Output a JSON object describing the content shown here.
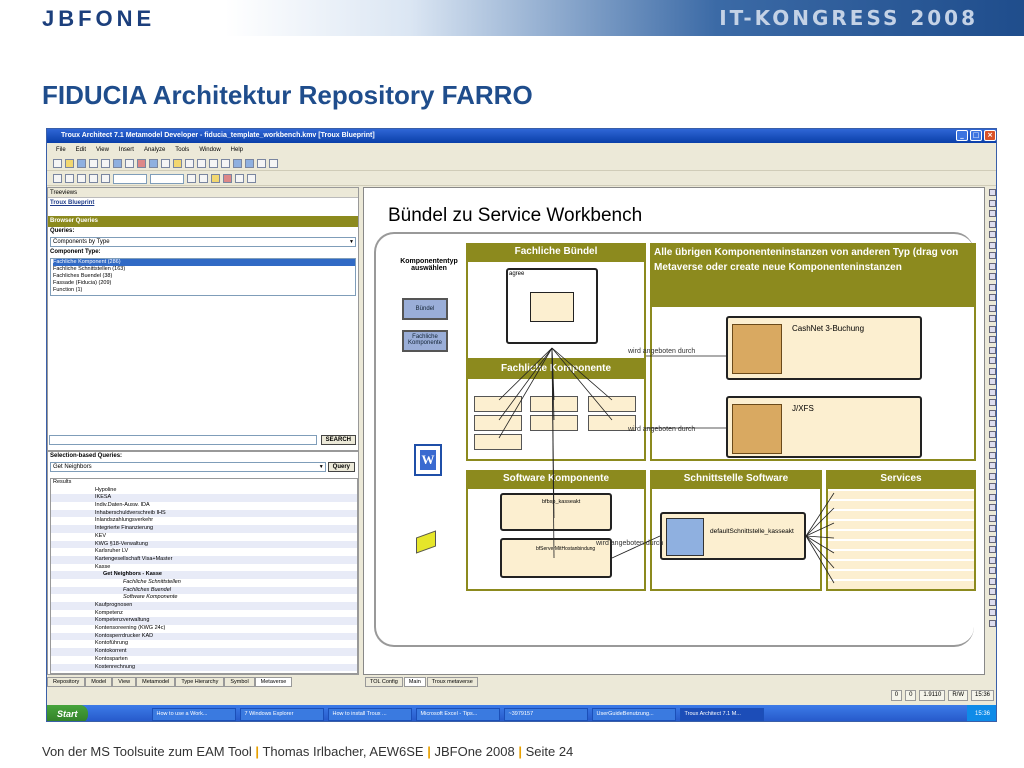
{
  "header": {
    "logo": "JBFONE",
    "event": "IT-KONGRESS 2008",
    "slide_title": "FIDUCIA Architektur Repository FARRO"
  },
  "footer": {
    "part1": "Von der MS Toolsuite zum EAM Tool",
    "part2": "Thomas Irlbacher, AEW6SE",
    "part3": "JBFOne 2008",
    "part4": "Seite 24"
  },
  "app": {
    "window_title": "Troux Architect 7.1 Metamodel Developer - fiducia_template_workbench.kmv [Troux Blueprint]",
    "menu": [
      "File",
      "Edit",
      "View",
      "Insert",
      "Analyze",
      "Tools",
      "Window",
      "Help"
    ],
    "left_panel": {
      "treeviews_label": "Treeviews",
      "blueprint_label": "Troux Blueprint",
      "browser_queries": "Browser Queries",
      "queries_label": "Queries:",
      "queries_value": "Components by Type",
      "component_type_label": "Component Type:",
      "component_types": [
        "Fachliche Komponent (286)",
        "Fachliche Schnittstellen (163)",
        "Fachliches Buendel (38)",
        "Fassade (Fiducia) (209)",
        "Function (1)"
      ],
      "search_button": "SEARCH",
      "selection_label": "Selection-based Queries:",
      "selection_value": "Get Neighbors",
      "query_button": "Query",
      "results_label": "Results",
      "results": [
        "Hypoline",
        "IKESA",
        "Indiv.Daten-Ausw. IDA",
        "Inhaberschuldverschreib IHS",
        "Inlandszahlungsverkehr",
        "Integrierte Finanzierung",
        "KEV",
        "KWG §18-Verwaltung",
        "Karlsruher LV",
        "Kartengesellschaft Visa+Master",
        "Kasse",
        "Get Neighbors - Kasse",
        "Fachliche Schnittstellen",
        "Fachliches Buendel",
        "Software Komponente",
        "Kaufprognosen",
        "Kompetenz",
        "Kompetenzverwaltung",
        "Kontensoreening (KWG 24c)",
        "Kontosperrdrucker KAD",
        "Kontoführung",
        "Kontokorrent",
        "Kontosparten",
        "Kostenrechnung"
      ],
      "tabs": [
        "Repository",
        "Model",
        "View",
        "Metamodel",
        "Type Hierarchy",
        "Symbol",
        "Metaverse"
      ]
    },
    "canvas": {
      "title": "Bündel zu Service Workbench",
      "component_type_label": "Komponententyp auswählen",
      "btn_buendel": "Bündel",
      "btn_fachliche": "Fachliche Komponente",
      "header_fb": "Fachliche Bündel",
      "header_fk": "Fachliche Komponente",
      "header_other": "Alle übrigen Komponenteninstanzen von anderen Typ (drag von Metaverse oder create neue Komponenteninstanzen",
      "header_sk": "Software Komponente",
      "header_ss": "Schnittstelle Software",
      "header_services": "Services",
      "cashnet": "CashNet 3-Buchung",
      "jxfs": "J/XFS",
      "edge1": "wird angeboten durch",
      "edge2": "wird angeboten durch",
      "edge3": "wird angeboten durch",
      "sk1": "bfbsp_kasseakt",
      "sk2": "bfServerMitHostanbindung",
      "ss1": "defaultSchnittstelle_kasseakt",
      "fb_inner": "agree",
      "tabs": [
        "TOL Config",
        "Main",
        "Troux metaverse"
      ]
    },
    "status": [
      "0",
      "0",
      "1.9110",
      "R/W",
      "15:36"
    ]
  },
  "taskbar": {
    "start": "Start",
    "tasks": [
      "How to use a Work...",
      "7 Windows Explorer",
      "How to install Troux ...",
      "Microsoft Excel - Tips...",
      "~3979157",
      "UserGuideBenutzung...",
      "Troux Architect 7.1 M..."
    ],
    "clock": "15:36"
  }
}
